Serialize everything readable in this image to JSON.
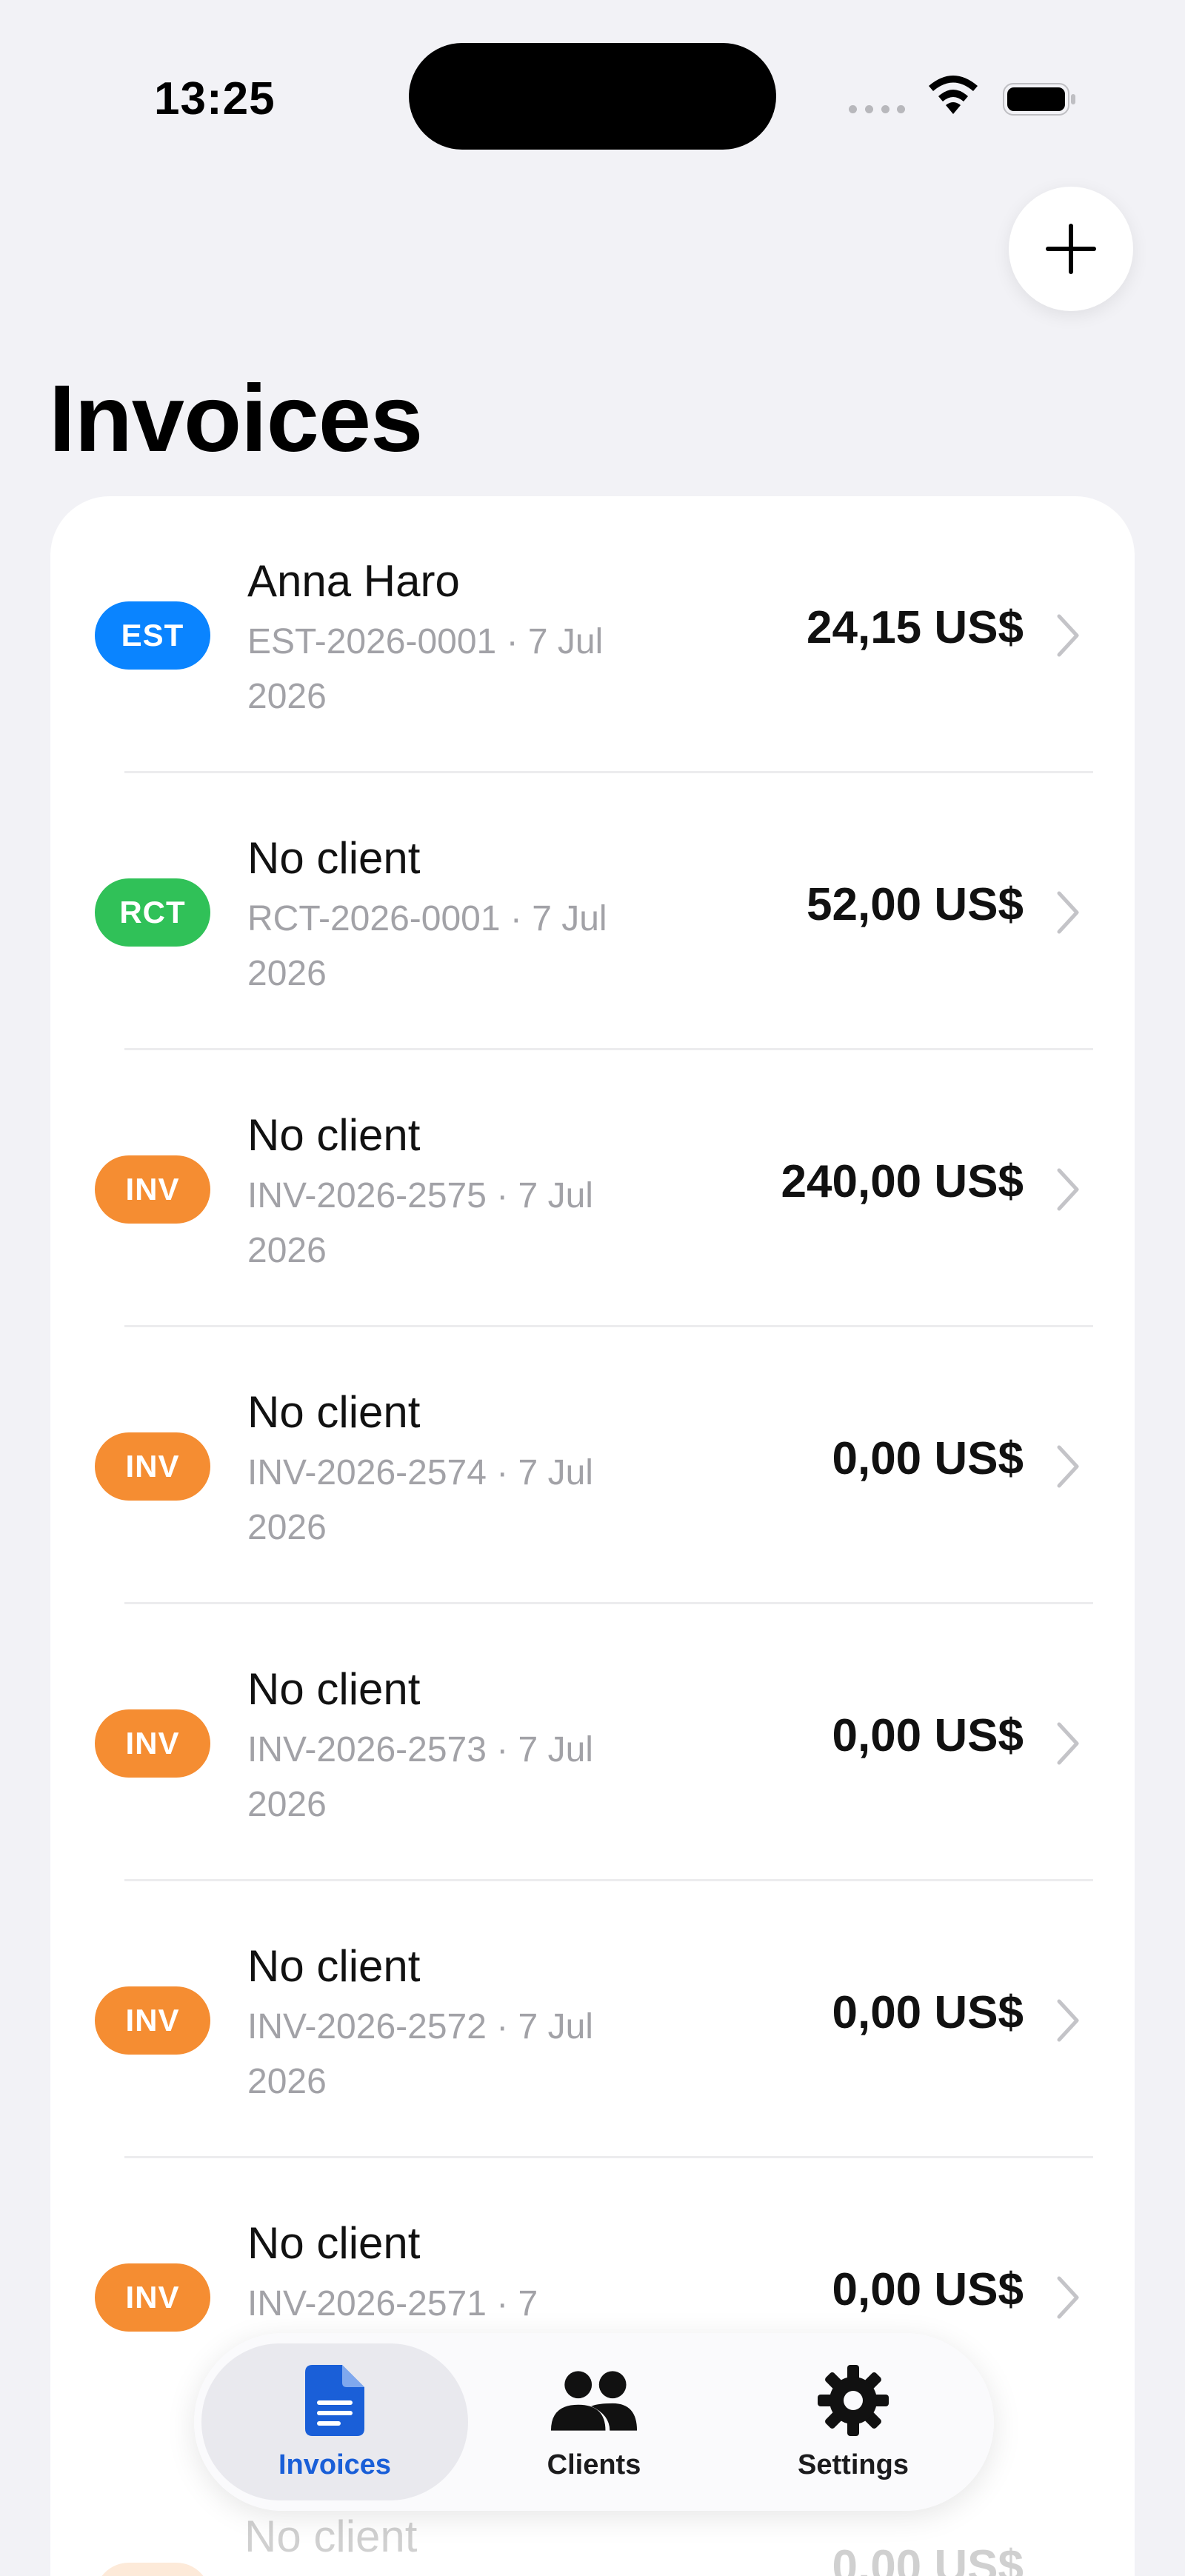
{
  "status_bar": {
    "time": "13:25"
  },
  "header": {
    "title": "Invoices",
    "add_icon": "plus-icon"
  },
  "invoices": [
    {
      "type": "EST",
      "client": "Anna Haro",
      "number_date": "EST-2026-0001 · 7 Jul 2026",
      "amount": "24,15 US$"
    },
    {
      "type": "RCT",
      "client": "No client",
      "number_date": "RCT-2026-0001 · 7 Jul 2026",
      "amount": "52,00 US$"
    },
    {
      "type": "INV",
      "client": "No client",
      "number_date": "INV-2026-2575 · 7 Jul 2026",
      "amount": "240,00 US$"
    },
    {
      "type": "INV",
      "client": "No client",
      "number_date": "INV-2026-2574 · 7 Jul 2026",
      "amount": "0,00 US$"
    },
    {
      "type": "INV",
      "client": "No client",
      "number_date": "INV-2026-2573 · 7 Jul 2026",
      "amount": "0,00 US$"
    },
    {
      "type": "INV",
      "client": "No client",
      "number_date": "INV-2026-2572 · 7 Jul 2026",
      "amount": "0,00 US$"
    },
    {
      "type": "INV",
      "client": "No client",
      "number_date": "INV-2026-2571 · 7",
      "amount": "0,00 US$"
    }
  ],
  "peek_row": {
    "client": "No client",
    "amount": "0,00 US$"
  },
  "tabs": [
    {
      "label": "Invoices",
      "icon": "document-icon",
      "active": true
    },
    {
      "label": "Clients",
      "icon": "people-icon",
      "active": false
    },
    {
      "label": "Settings",
      "icon": "gear-icon",
      "active": false
    }
  ],
  "colors": {
    "estimate": "#0a84ff",
    "receipt": "#30c158",
    "invoice": "#f58d32",
    "active_tab": "#1a5fd8"
  }
}
